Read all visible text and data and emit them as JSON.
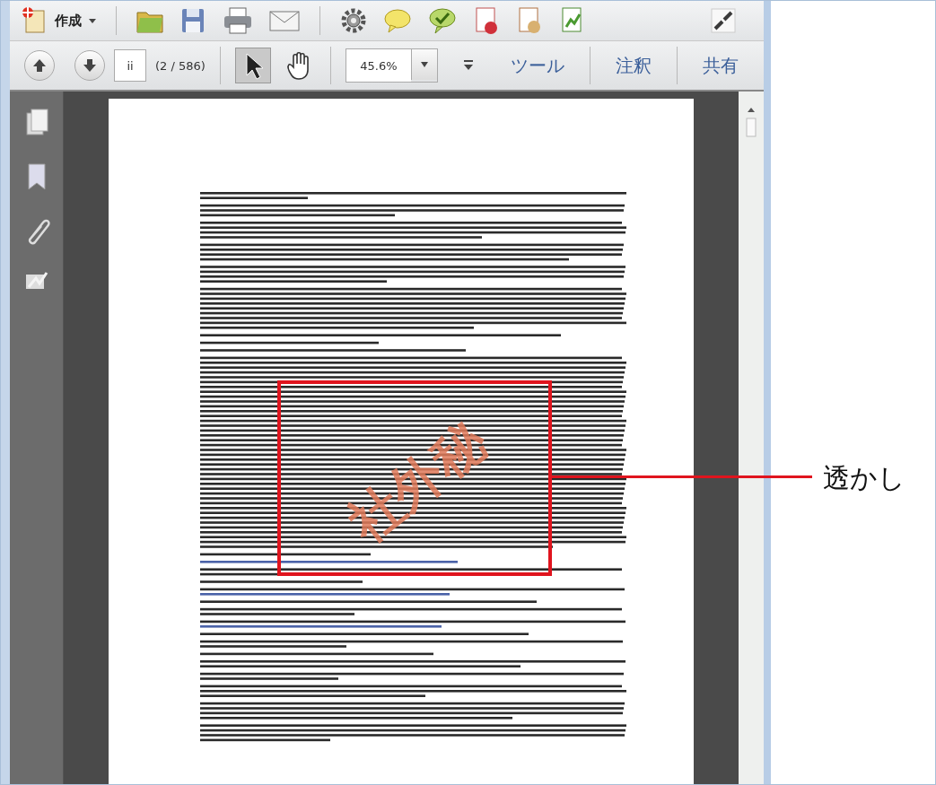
{
  "toolbar": {
    "create_label": "作成",
    "page_value": "ii",
    "page_count": "(2 / 586)",
    "zoom_value": "45.6%",
    "panels": [
      "ツール",
      "注釈",
      "共有"
    ]
  },
  "tools": [
    {
      "kind": "select",
      "selected": true
    },
    {
      "kind": "hand",
      "selected": false
    }
  ],
  "document": {
    "watermark": "社外秘"
  },
  "callout": {
    "label": "透かし"
  }
}
